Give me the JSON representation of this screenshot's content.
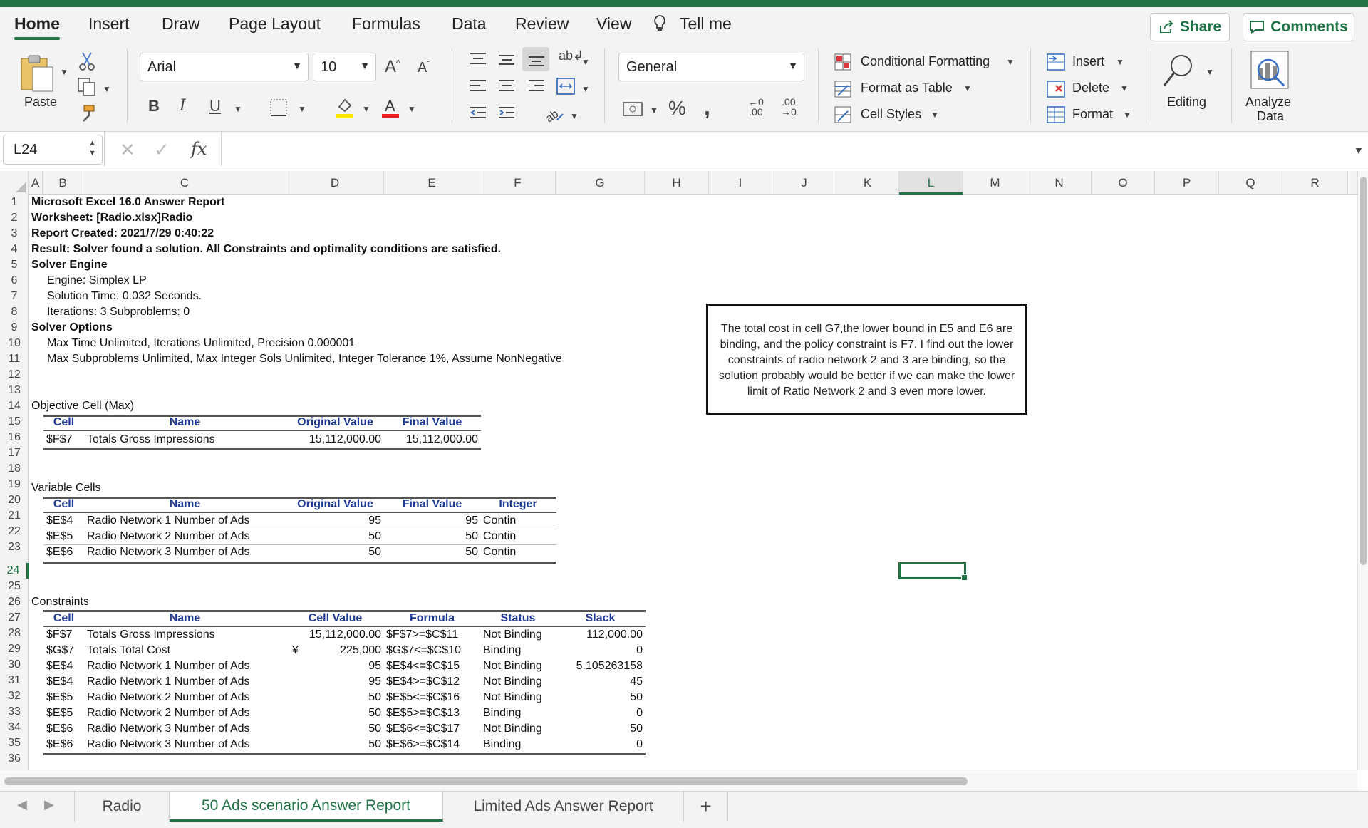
{
  "tabs": [
    "Home",
    "Insert",
    "Draw",
    "Page Layout",
    "Formulas",
    "Data",
    "Review",
    "View"
  ],
  "tell_me": "Tell me",
  "share_label": "Share",
  "comments_label": "Comments",
  "ribbon": {
    "paste_label": "Paste",
    "font_name": "Arial",
    "font_size": "10",
    "number_format": "General",
    "conditional_formatting": "Conditional Formatting",
    "format_as_table": "Format as Table",
    "cell_styles": "Cell Styles",
    "insert": "Insert",
    "delete": "Delete",
    "format": "Format",
    "editing": "Editing",
    "analyze_line1": "Analyze",
    "analyze_line2": "Data"
  },
  "formula_bar": {
    "name_box": "L24",
    "fx": "fx",
    "formula": ""
  },
  "columns": [
    "A",
    "B",
    "C",
    "D",
    "E",
    "F",
    "G",
    "H",
    "I",
    "J",
    "K",
    "L",
    "M",
    "N",
    "O",
    "P",
    "Q",
    "R"
  ],
  "selected_column": "L",
  "selected_row": "24",
  "rows": [
    "1",
    "2",
    "3",
    "4",
    "5",
    "6",
    "7",
    "8",
    "9",
    "10",
    "11",
    "12",
    "13",
    "14",
    "15",
    "16",
    "17",
    "18",
    "19",
    "20",
    "21",
    "22",
    "23",
    "24",
    "25",
    "26",
    "27",
    "28",
    "29",
    "30",
    "31",
    "32",
    "33",
    "34",
    "35",
    "36"
  ],
  "report": {
    "r1": "Microsoft Excel 16.0 Answer Report",
    "r2": "Worksheet: [Radio.xlsx]Radio",
    "r3": "Report Created: 2021/7/29 0:40:22",
    "r4": "Result: Solver found a solution.  All Constraints and optimality conditions are satisfied.",
    "r5": "Solver Engine",
    "r6": "Engine: Simplex LP",
    "r7": "Solution Time: 0.032 Seconds.",
    "r8": "Iterations: 3 Subproblems: 0",
    "r9": "Solver Options",
    "r10": "Max Time Unlimited,  Iterations Unlimited, Precision 0.000001",
    "r11": "Max Subproblems Unlimited, Max Integer Sols Unlimited, Integer Tolerance 1%, Assume NonNegative"
  },
  "objective": {
    "title": "Objective Cell (Max)",
    "headers": [
      "Cell",
      "Name",
      "Original Value",
      "Final Value"
    ],
    "row": [
      "$F$7",
      "Totals Gross Impressions",
      "15,112,000.00",
      "15,112,000.00"
    ]
  },
  "variables": {
    "title": "Variable Cells",
    "headers": [
      "Cell",
      "Name",
      "Original Value",
      "Final Value",
      "Integer"
    ],
    "rows": [
      [
        "$E$4",
        "Radio Network 1 Number of Ads",
        "95",
        "95",
        "Contin"
      ],
      [
        "$E$5",
        "Radio Network 2 Number of Ads",
        "50",
        "50",
        "Contin"
      ],
      [
        "$E$6",
        "Radio Network 3 Number of Ads",
        "50",
        "50",
        "Contin"
      ]
    ]
  },
  "constraints": {
    "title": "Constraints",
    "headers": [
      "Cell",
      "Name",
      "Cell Value",
      "Formula",
      "Status",
      "Slack"
    ],
    "currency_symbol": "¥",
    "rows": [
      [
        "$F$7",
        "Totals Gross Impressions",
        "15,112,000.00",
        "$F$7>=$C$11",
        "Not Binding",
        "112,000.00"
      ],
      [
        "$G$7",
        "Totals Total Cost",
        "225,000",
        "$G$7<=$C$10",
        "Binding",
        "0"
      ],
      [
        "$E$4",
        "Radio Network 1 Number of Ads",
        "95",
        "$E$4<=$C$15",
        "Not Binding",
        "5.105263158"
      ],
      [
        "$E$4",
        "Radio Network 1 Number of Ads",
        "95",
        "$E$4>=$C$12",
        "Not Binding",
        "45"
      ],
      [
        "$E$5",
        "Radio Network 2 Number of Ads",
        "50",
        "$E$5<=$C$16",
        "Not Binding",
        "50"
      ],
      [
        "$E$5",
        "Radio Network 2 Number of Ads",
        "50",
        "$E$5>=$C$13",
        "Binding",
        "0"
      ],
      [
        "$E$6",
        "Radio Network 3 Number of Ads",
        "50",
        "$E$6<=$C$17",
        "Not Binding",
        "50"
      ],
      [
        "$E$6",
        "Radio Network 3 Number of Ads",
        "50",
        "$E$6>=$C$14",
        "Binding",
        "0"
      ]
    ]
  },
  "textbox": "The total cost in cell G7,the lower bound in E5 and E6 are binding, and the policy constraint is F7. I find out the lower constraints of radio network 2 and 3 are binding, so the solution probably would be better if we can make the lower limit of Ratio Network 2 and 3 even more lower.",
  "sheets": [
    "Radio",
    "50 Ads scenario Answer Report",
    "Limited Ads Answer Report"
  ],
  "active_sheet": "50 Ads scenario Answer Report",
  "add_sheet": "+",
  "colors": {
    "accent": "#217346",
    "header_text": "#1f3a93"
  }
}
